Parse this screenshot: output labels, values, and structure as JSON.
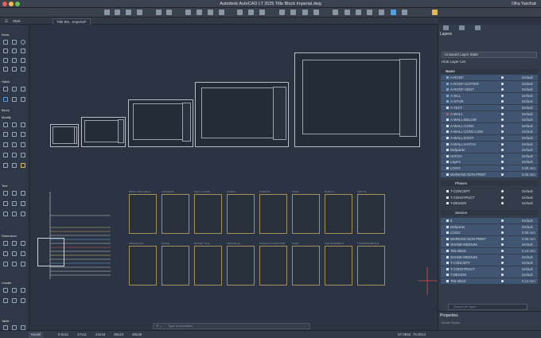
{
  "window": {
    "title": "Autodesk AutoCAD LT 2025   Title Block Imperial.dwg",
    "user": "Olha Yanchuk"
  },
  "tabs": [
    {
      "label": "Start"
    },
    {
      "label": "Title Blo...Imperial*"
    }
  ],
  "palette": {
    "groups": [
      "Draw",
      "Hatch",
      "Block",
      "Modify",
      "Text",
      "Dimension",
      "Leader",
      "Table"
    ]
  },
  "hatch_labels": [
    "BRICK WITH FIELD",
    "LINOLEUM",
    "SHALL LAYER",
    "ELMON",
    "ELMON B",
    "STEEL",
    "BASE TL",
    "SOFT TL",
    "ORGANIZ ML",
    "SHAKE",
    "BASKET TILE",
    "ORNATE ML",
    "STUCCO PLAINSTONE",
    "SAND",
    "TILE BONDMENT",
    "TILE BONDMENT B"
  ],
  "command": {
    "placeholder": "Type a command",
    "close": "✕ ⌄"
  },
  "status": {
    "tabs": [
      "Model",
      "8.5x11",
      "17x11",
      "24x18",
      "36x24",
      "48x36"
    ],
    "coords": "97.0652, 79.3014"
  },
  "layers": {
    "title": "Layers",
    "state": "Unsaved Layer State",
    "hide_list": "Hide Layer List",
    "column_name": "Name",
    "rows": [
      {
        "name": "A-ROOF",
        "color": "#6bb0e0",
        "lt": "Default",
        "selected": true
      },
      {
        "name": "A-ROOF-GUTTER",
        "color": "#6bb0e0",
        "lt": "Default",
        "selected": true
      },
      {
        "name": "A-ROOF-VENT",
        "color": "#6bb0e0",
        "lt": "Default",
        "selected": true
      },
      {
        "name": "A-SILL",
        "color": "#6bb0e0",
        "lt": "Default",
        "selected": true
      },
      {
        "name": "A-STAIR",
        "color": "#6bb0e0",
        "lt": "Default",
        "selected": true
      },
      {
        "name": "A-TEXT",
        "color": "#e8e8e8",
        "lt": "Default",
        "selected": true
      },
      {
        "name": "A-WALL",
        "color": "#e05050",
        "lt": "Default",
        "selected": true
      },
      {
        "name": "A-WALL-BELOW",
        "color": "#e8e8e8",
        "lt": "Default",
        "selected": true
      },
      {
        "name": "A-WALL-CONC",
        "color": "#e8e8e8",
        "lt": "Default",
        "selected": true
      },
      {
        "name": "A-WALL-CONC-LOW",
        "color": "#e8e8e8",
        "lt": "Default",
        "selected": true
      },
      {
        "name": "A-WALL-EXIST",
        "color": "#e8e8e8",
        "lt": "Default",
        "selected": true
      },
      {
        "name": "A-WALL-HATCH",
        "color": "#e8e8e8",
        "lt": "Default",
        "selected": true
      },
      {
        "name": "Defpoints",
        "color": "#e8e8e8",
        "lt": "Default",
        "selected": true
      },
      {
        "name": "HATCH",
        "color": "#e8e8e8",
        "lt": "Default",
        "selected": true
      },
      {
        "name": "Layer1",
        "color": "#e8e8e8",
        "lt": "Default",
        "selected": true
      },
      {
        "name": "LOGO",
        "color": "#e8e8e8",
        "lt": "0.05 mm",
        "selected": true
      },
      {
        "name": "MARKING NON PRINT",
        "color": "#e8e8e8",
        "lt": "0.05 mm",
        "selected": true
      }
    ],
    "group1": "Phases",
    "group1_rows": [
      {
        "name": "T-CONCEPT",
        "lt": "Default"
      },
      {
        "name": "T-CONSTRUCT",
        "lt": "Default"
      },
      {
        "name": "T-DESIGN",
        "lt": "Default"
      }
    ],
    "group2": "Service",
    "group2_rows": [
      {
        "name": "0",
        "lt": "Default"
      },
      {
        "name": "Defpoints",
        "lt": "Default"
      },
      {
        "name": "LOGO",
        "lt": "0.05 mm"
      },
      {
        "name": "MARKING NON PRINT",
        "lt": "0.05 mm"
      },
      {
        "name": "SHADE-MEDIUM",
        "lt": "Default"
      },
      {
        "name": "Title Block",
        "lt": "0.13 mm"
      }
    ],
    "tail_rows": [
      {
        "name": "SHADE-MEDIUM",
        "lt": "Default"
      },
      {
        "name": "T-CONCEPT",
        "lt": "Default"
      },
      {
        "name": "T-CONSTRUCT",
        "lt": "Default"
      },
      {
        "name": "T-DESIGN",
        "lt": "Default"
      },
      {
        "name": "Title Block",
        "lt": "0.13 mm"
      }
    ],
    "search_placeholder": "Search for layer"
  },
  "properties": {
    "title": "Properties",
    "sub": "Model Space"
  }
}
